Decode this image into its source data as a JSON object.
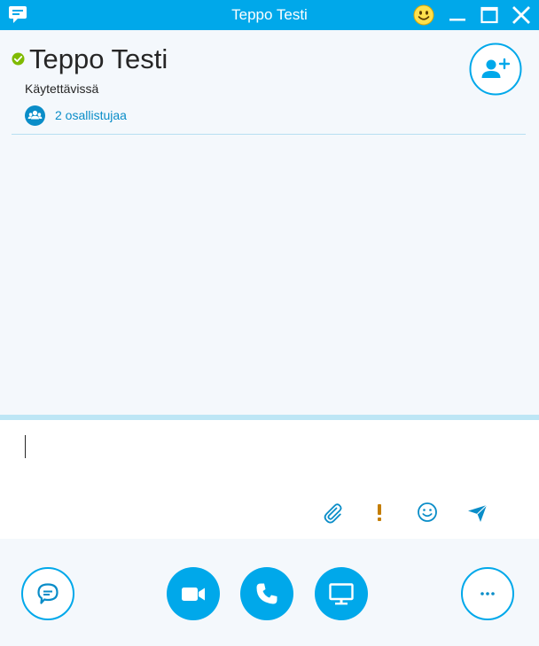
{
  "window": {
    "title": "Teppo Testi",
    "accent_color": "#00a8ea",
    "icons": [
      "skype-chat-icon",
      "smiley-icon",
      "minimize-icon",
      "maximize-icon",
      "close-icon"
    ]
  },
  "header": {
    "contact_name": "Teppo Testi",
    "presence_status": "Käytettävissä",
    "presence_color": "#7fba00",
    "participants_label": "2 osallistujaa",
    "add_person_icon": "add-person-icon"
  },
  "compose": {
    "message_value": "",
    "tools": [
      "paperclip-icon",
      "exclamation-icon",
      "emoji-icon",
      "send-icon"
    ]
  },
  "actions": {
    "buttons": [
      "chat-bubble-icon",
      "video-camera-icon",
      "phone-icon",
      "monitor-icon",
      "more-icon"
    ]
  }
}
